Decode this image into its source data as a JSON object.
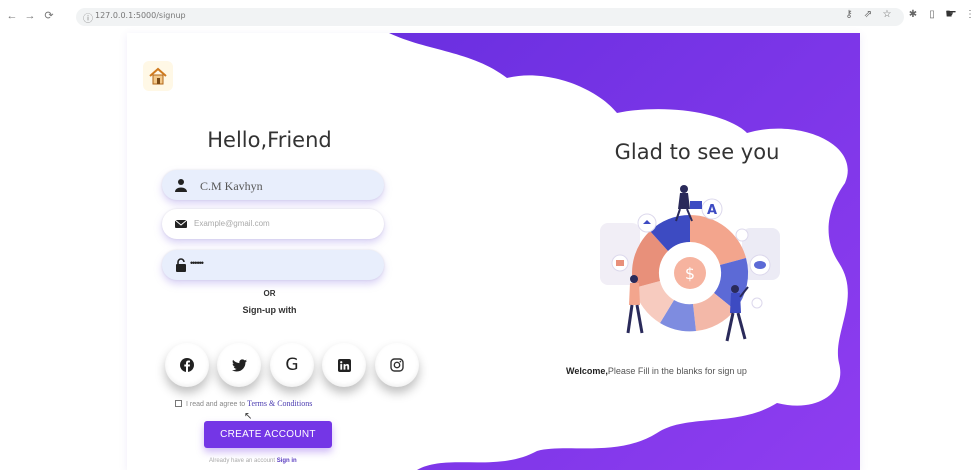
{
  "browser": {
    "url": "127.0.0.1:5000/signup",
    "back_icon": "back-arrow-icon",
    "forward_icon": "forward-arrow-icon",
    "reload_icon": "reload-icon"
  },
  "colors": {
    "accent": "#7436e6",
    "purple_bg": "#7a36e8",
    "field_filled": "#e8eefc"
  },
  "form": {
    "title": "Hello,Friend",
    "name_value": "C.M Kavhyn",
    "email_placeholder": "Example@gmail.com",
    "password_value": "••••••",
    "or_label": "OR",
    "signup_with_label": "Sign-up with",
    "social": [
      "facebook",
      "twitter",
      "google",
      "linkedin",
      "instagram"
    ],
    "terms_prefix": "I read and agree to",
    "terms_link": "Terms & Conditions",
    "create_button": "CREATE ACCOUNT",
    "already_text": "Already have an account",
    "signin_link": "Sign in"
  },
  "panel": {
    "title": "Glad to see you",
    "welcome_bold": "Welcome,",
    "welcome_text": "Please Fill in the blanks for sign up"
  }
}
